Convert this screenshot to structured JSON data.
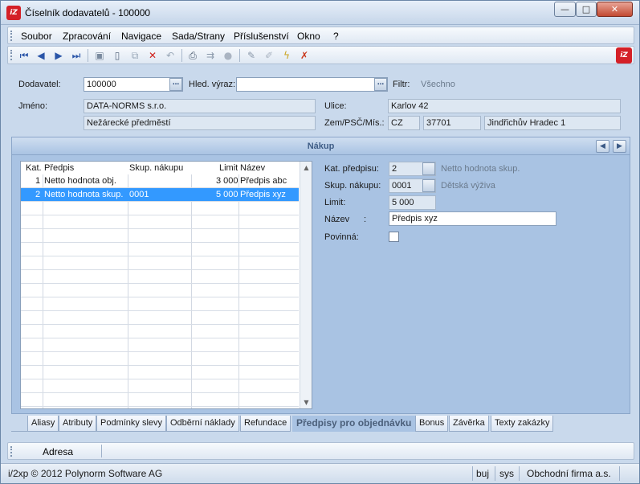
{
  "window": {
    "logo": "iZ",
    "title": "Číselník dodavatelů - 100000",
    "minimize": "—",
    "maximize": "□",
    "close": "✕"
  },
  "menu": [
    "Soubor",
    "Zpracování",
    "Navigace",
    "Sada/Strany",
    "Příslušenství",
    "Okno",
    "?"
  ],
  "toolbar": {
    "icons": [
      "first-record-icon",
      "previous-record-icon",
      "next-record-icon",
      "last-record-icon",
      "save-icon",
      "new-icon",
      "copy-icon",
      "delete-icon",
      "undo-icon",
      "print-icon",
      "export-icon",
      "disabled-icon",
      "edit-icon",
      "pen-icon",
      "wizard-icon",
      "tools-icon"
    ]
  },
  "header": {
    "dodavatel_label": "Dodavatel:",
    "dodavatel_value": "100000",
    "hled_label": "Hled. výraz:",
    "hled_value": "",
    "filtr_label": "Filtr:",
    "filtr_value": "Všechno",
    "jmeno_label": "Jméno:",
    "jmeno_line1": "DATA-NORMS s.r.o.",
    "jmeno_line2": "Nežárecké předměstí",
    "ulice_label": "Ulice:",
    "ulice_value": "Karlov 42",
    "zem_label": "Zem/PSČ/Mís.:",
    "zem_value": "CZ",
    "psc_value": "37701",
    "misto_value": "Jindřichův Hradec 1",
    "ellipsis": "..."
  },
  "section": {
    "title": "Nákup",
    "prev": "◀",
    "next": "▶"
  },
  "grid": {
    "columns": [
      "Kat.",
      "Předpis",
      "Skup. nákupu",
      "Limit",
      "Název"
    ],
    "rows": [
      {
        "kat": "1",
        "predpis": "Netto hodnota obj.",
        "skup": "",
        "limit": "3 000",
        "nazev": "Předpis abc"
      },
      {
        "kat": "2",
        "predpis": "Netto hodnota skup.",
        "skup": "0001",
        "limit": "5 000",
        "nazev": "Předpis xyz"
      }
    ]
  },
  "detail": {
    "kat_label": "Kat. předpisu:",
    "kat_value": "2",
    "kat_desc": "Netto hodnota skup.",
    "skup_label": "Skup. nákupu:",
    "skup_value": "0001",
    "skup_desc": "Dětská výživa",
    "limit_label": "Limit:",
    "limit_value": "5 000",
    "nazev_label": "Název",
    "nazev_colon": ":",
    "nazev_value": "Předpis xyz",
    "povinna_label": "Povinná:"
  },
  "tabs": [
    "Aliasy",
    "Atributy",
    "Podmínky slevy",
    "Odběrní náklady",
    "Refundace",
    "Předpisy pro objednávku",
    "Bonus",
    "Závěrka",
    "Texty zakázky"
  ],
  "active_tab": "Předpisy pro objednávku",
  "adresa": "Adresa",
  "status": {
    "copyright": "i/2xp © 2012 Polynorm Software AG",
    "user": "buj",
    "db": "sys",
    "company": "Obchodní firma a.s."
  }
}
